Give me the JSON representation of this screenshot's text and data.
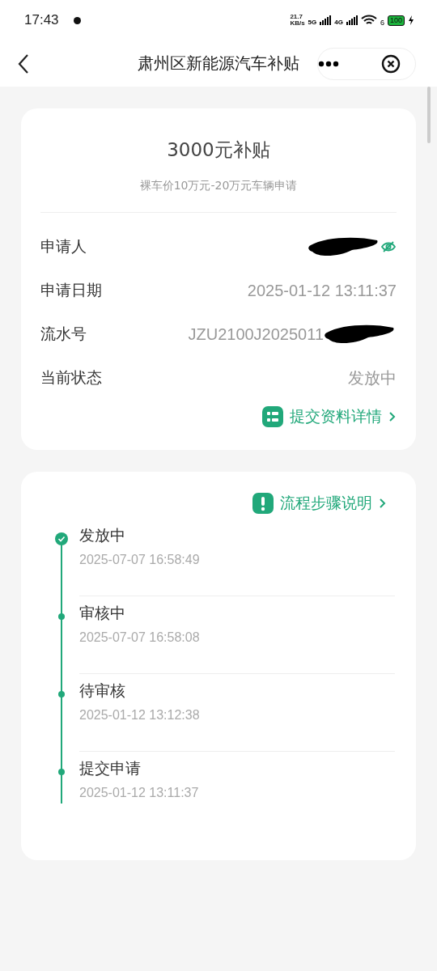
{
  "status_bar": {
    "time": "17:43",
    "speed_value": "21.7",
    "speed_unit": "KB/s",
    "network_1": "5G",
    "network_2": "4G",
    "wifi_number": "6",
    "battery": "100"
  },
  "nav": {
    "title": "肃州区新能源汽车补贴"
  },
  "summary": {
    "amount": "3000元补贴",
    "subtitle": "裸车价10万元-20万元车辆申请",
    "fields": [
      {
        "kind": "hidden",
        "label": "申请人"
      },
      {
        "kind": "partial",
        "label": "申请日期",
        "value": "2025-01-12 13:11:37",
        "redacted": false
      },
      {
        "kind": "partial",
        "label": "流水号",
        "value": "JZU2100J2025011",
        "redacted": true
      },
      {
        "kind": "partial",
        "label": "当前状态",
        "value": "发放中",
        "redacted": false
      }
    ],
    "link": "提交资料详情"
  },
  "process": {
    "link": "流程步骤说明",
    "steps": [
      {
        "title": "发放中",
        "time": "2025-07-07 16:58:49",
        "current": true
      },
      {
        "title": "审核中",
        "time": "2025-07-07 16:58:08",
        "current": false
      },
      {
        "title": "待审核",
        "time": "2025-01-12 13:12:38",
        "current": false
      },
      {
        "title": "提交申请",
        "time": "2025-01-12 13:11:37",
        "current": false
      }
    ]
  }
}
